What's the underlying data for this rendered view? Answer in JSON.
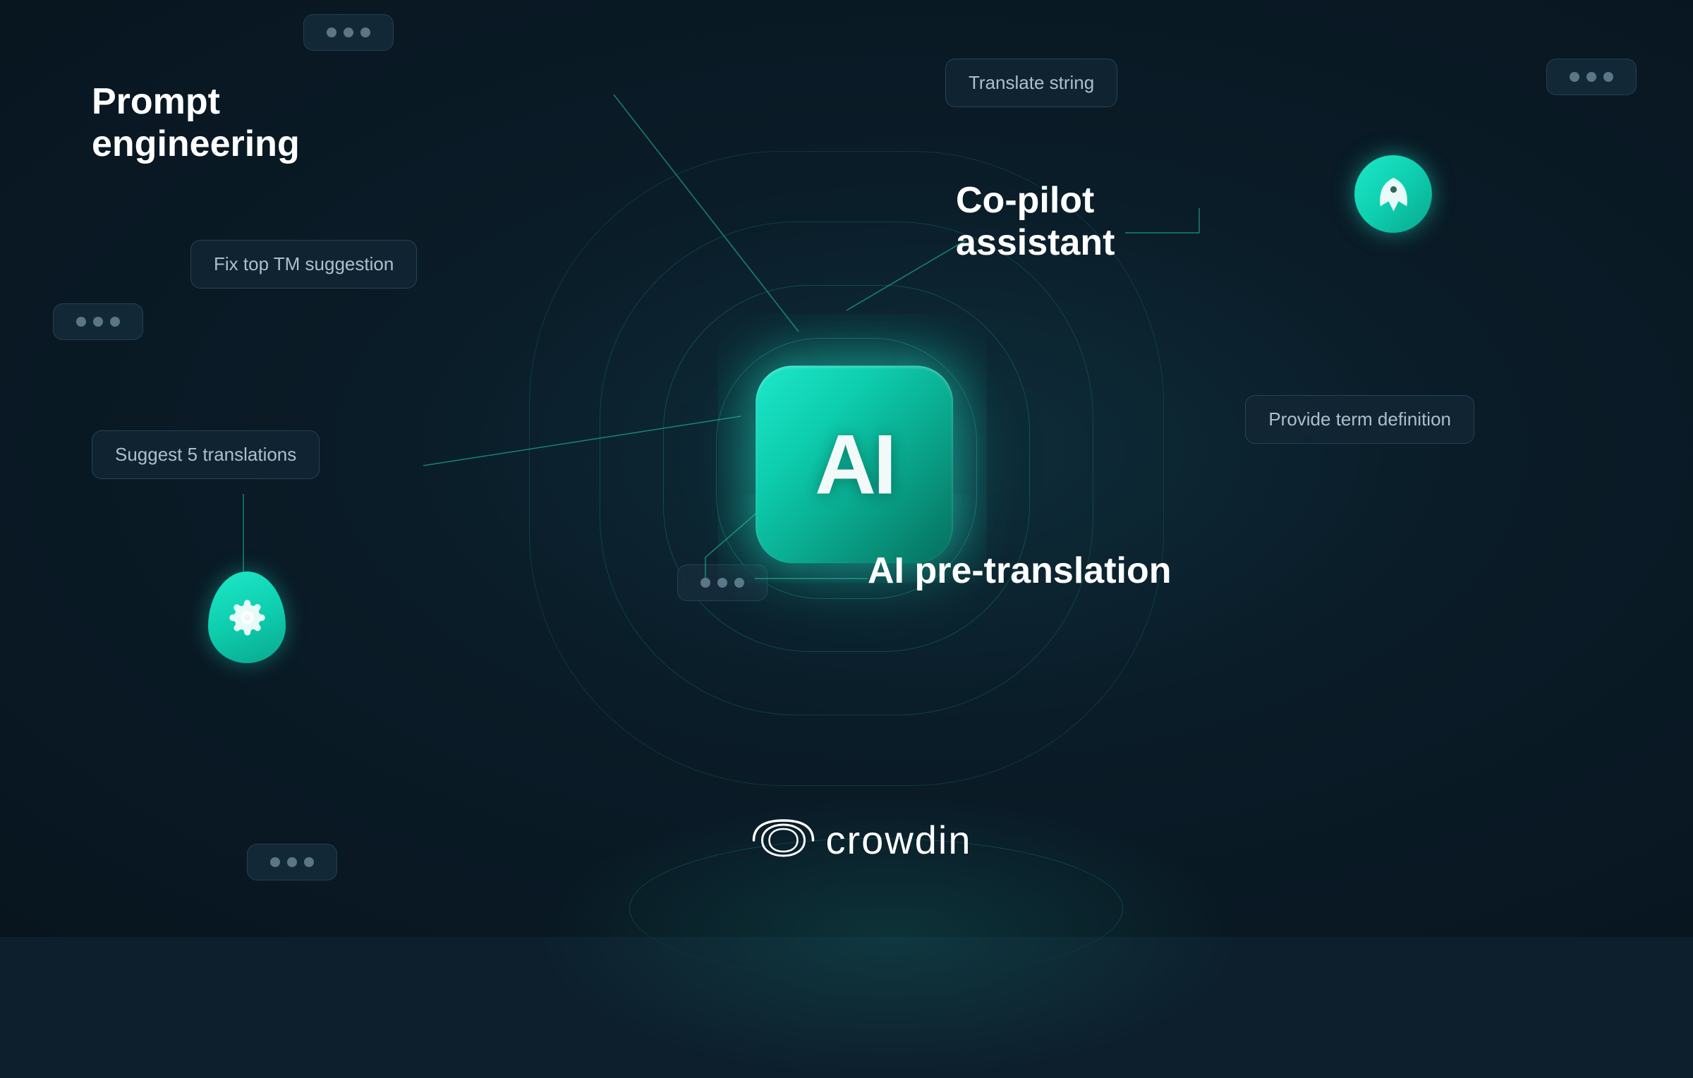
{
  "background": {
    "color": "#0d1f2d"
  },
  "ai_chip": {
    "label": "AI"
  },
  "labels": {
    "prompt_engineering": "Prompt\nengineering",
    "copilot_assistant": "Co-pilot\nassistant",
    "ai_pretranslation": "AI pre-translation"
  },
  "pills": {
    "translate_string": "Translate string",
    "fix_tm_suggestion": "Fix top TM suggestion",
    "suggest_translations": "Suggest 5 translations",
    "provide_term_definition": "Provide term definition"
  },
  "crowdin_logo": {
    "text": "crowdin",
    "icon_alt": "crowdin logo"
  },
  "dots_pill_1": "• • •",
  "dots_pill_2": "• • •",
  "dots_pill_3": "• • •",
  "dots_pill_4": "• • •"
}
